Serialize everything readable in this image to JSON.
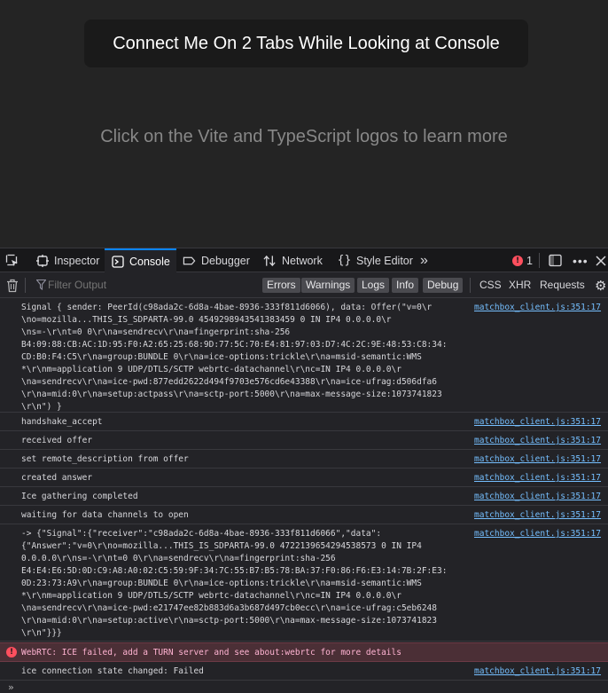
{
  "page": {
    "button_label": "Connect Me On 2 Tabs While Looking at Console",
    "hint": "Click on the Vite and TypeScript logos to learn more"
  },
  "devtools": {
    "tabs": [
      {
        "label": "Inspector",
        "icon": "inspector-icon",
        "selected": false
      },
      {
        "label": "Console",
        "icon": "console-icon",
        "selected": true
      },
      {
        "label": "Debugger",
        "icon": "debugger-icon",
        "selected": false
      },
      {
        "label": "Network",
        "icon": "network-icon",
        "selected": false
      },
      {
        "label": "Style Editor",
        "icon": "style-editor-icon",
        "selected": false
      }
    ],
    "error_count": "1",
    "accent_color": "#0a84ff",
    "error_color": "#ff4f5e",
    "link_color": "#75bfff"
  },
  "filter": {
    "placeholder": "Filter Output",
    "levels": [
      "Errors",
      "Warnings",
      "Logs",
      "Info",
      "Debug"
    ],
    "categories": [
      "CSS",
      "XHR",
      "Requests"
    ]
  },
  "console": {
    "messages": [
      {
        "type": "log",
        "source": "matchbox_client.js:351:17",
        "text": "Signal { sender: PeerId(c98ada2c-6d8a-4bae-8936-333f811d6066), data: Offer(\"v=0\\r\n\\no=mozilla...THIS_IS_SDPARTA-99.0 4549298943541383459 0 IN IP4 0.0.0.0\\r\n\\ns=-\\r\\nt=0 0\\r\\na=sendrecv\\r\\na=fingerprint:sha-256\nB4:09:88:CB:AC:1D:95:F0:A2:65:25:68:9D:77:5C:70:E4:81:97:03:D7:4C:2C:9E:48:53:C8:34:\nCD:B0:F4:C5\\r\\na=group:BUNDLE 0\\r\\na=ice-options:trickle\\r\\na=msid-semantic:WMS\n*\\r\\nm=application 9 UDP/DTLS/SCTP webrtc-datachannel\\r\\nc=IN IP4 0.0.0.0\\r\n\\na=sendrecv\\r\\na=ice-pwd:877edd2622d494f9703e576cd6e43388\\r\\na=ice-ufrag:d506dfa6\n\\r\\na=mid:0\\r\\na=setup:actpass\\r\\na=sctp-port:5000\\r\\na=max-message-size:1073741823\n\\r\\n\") }"
      },
      {
        "type": "log",
        "source": "matchbox_client.js:351:17",
        "text": "handshake_accept"
      },
      {
        "type": "log",
        "source": "matchbox_client.js:351:17",
        "text": "received offer"
      },
      {
        "type": "log",
        "source": "matchbox_client.js:351:17",
        "text": "set remote_description from offer"
      },
      {
        "type": "log",
        "source": "matchbox_client.js:351:17",
        "text": "created answer"
      },
      {
        "type": "log",
        "source": "matchbox_client.js:351:17",
        "text": "Ice gathering completed"
      },
      {
        "type": "log",
        "source": "matchbox_client.js:351:17",
        "text": "waiting for data channels to open"
      },
      {
        "type": "log",
        "source": "matchbox_client.js:351:17",
        "text": "-> {\"Signal\":{\"receiver\":\"c98ada2c-6d8a-4bae-8936-333f811d6066\",\"data\":\n{\"Answer\":\"v=0\\r\\no=mozilla...THIS_IS_SDPARTA-99.0 4722139654294538573 0 IN IP4\n0.0.0.0\\r\\ns=-\\r\\nt=0 0\\r\\na=sendrecv\\r\\na=fingerprint:sha-256\nE4:E4:E6:5D:0D:C9:A8:A0:02:C5:59:9F:34:7C:55:B7:B5:78:BA:37:F0:86:F6:E3:14:7B:2F:E3:\n0D:23:73:A9\\r\\na=group:BUNDLE 0\\r\\na=ice-options:trickle\\r\\na=msid-semantic:WMS\n*\\r\\nm=application 9 UDP/DTLS/SCTP webrtc-datachannel\\r\\nc=IN IP4 0.0.0.0\\r\n\\na=sendrecv\\r\\na=ice-pwd:e21747ee82b883d6a3b687d497cb0ecc\\r\\na=ice-ufrag:c5eb6248\n\\r\\na=mid:0\\r\\na=setup:active\\r\\na=sctp-port:5000\\r\\na=max-message-size:1073741823\n\\r\\n\"}}}"
      },
      {
        "type": "error",
        "source": "",
        "text": "WebRTC: ICE failed, add a TURN server and see about:webrtc for more details"
      },
      {
        "type": "log",
        "source": "matchbox_client.js:351:17",
        "text": "ice connection state changed: Failed"
      }
    ]
  },
  "input": {
    "prompt": "»"
  }
}
